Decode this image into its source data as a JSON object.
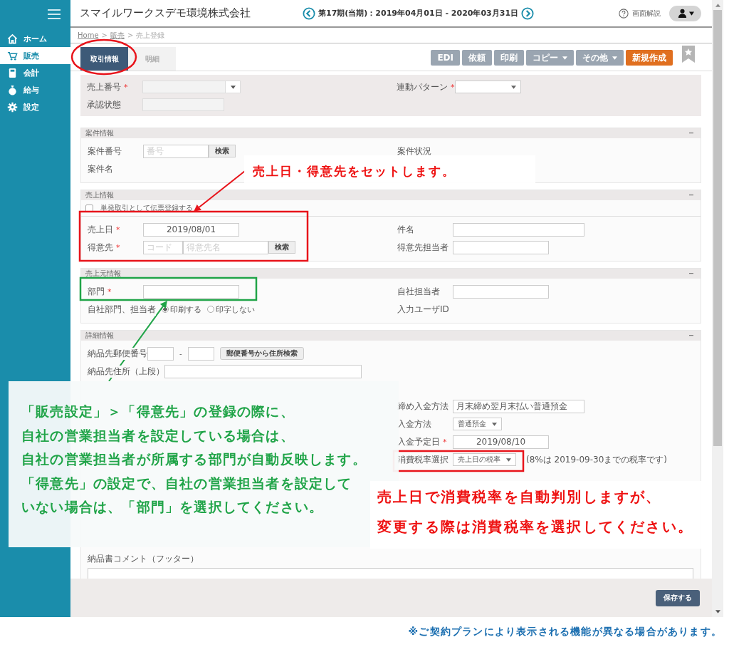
{
  "sidebar": {
    "items": [
      {
        "label": "ホーム",
        "selected": false
      },
      {
        "label": "販売",
        "selected": true
      },
      {
        "label": "会計",
        "selected": false
      },
      {
        "label": "給与",
        "selected": false
      },
      {
        "label": "設定",
        "selected": false
      }
    ]
  },
  "header": {
    "company": "スマイルワークスデモ環境株式会社",
    "period": "第17期(当期)：2019年04月01日 - 2020年03月31日",
    "help": "画面解説"
  },
  "breadcrumb": [
    {
      "label": "Home",
      "kind": "link"
    },
    {
      "label": ">",
      "kind": "separator"
    },
    {
      "label": "販売",
      "kind": "link"
    },
    {
      "label": ">",
      "kind": "separator"
    },
    {
      "label": "売上登録",
      "kind": "current"
    }
  ],
  "tabs": [
    {
      "label": "取引情報",
      "selected": true
    },
    {
      "label": "明細",
      "selected": false
    }
  ],
  "toolbar": [
    {
      "label": "EDI",
      "kind": "button",
      "disabled": true
    },
    {
      "label": "依頼",
      "kind": "button",
      "disabled": true
    },
    {
      "label": "印刷",
      "kind": "button",
      "disabled": true
    },
    {
      "label": "コピー",
      "kind": "dropdown",
      "disabled": true
    },
    {
      "label": "その他",
      "kind": "dropdown",
      "disabled": true
    },
    {
      "label": "新規作成",
      "kind": "button",
      "disabled": false
    }
  ],
  "sections": [
    {
      "kind": "plain",
      "left": [
        {
          "label": "売上番号",
          "mark": "*",
          "kind": "combo"
        },
        {
          "label": "承認状態",
          "kind": "readonly"
        }
      ],
      "right": [
        {
          "label": "連動パターン",
          "mark": "*",
          "kind": "select"
        }
      ]
    },
    {
      "kind": "basic",
      "title": "案件情報",
      "left": [
        {
          "label": "案件番号",
          "kind": "search",
          "placeholder": "番号",
          "button": "検索"
        },
        {
          "label": "案件名",
          "kind": "label"
        }
      ],
      "right": [
        {
          "label": "案件状況",
          "kind": "label"
        }
      ]
    },
    {
      "kind": "basic",
      "title": "売上情報",
      "checkbox": {
        "label": "単発取引として伝票登録する",
        "checked": false
      },
      "left": [
        {
          "label": "売上日",
          "mark": "*",
          "kind": "date",
          "value": "2019/08/01"
        },
        {
          "label": "得意先",
          "mark": "*",
          "kind": "customer",
          "placeholders": [
            "コード",
            "得意先名"
          ],
          "button": "検索"
        }
      ],
      "right": [
        {
          "label": "件名",
          "kind": "long-text"
        },
        {
          "label": "得意先担当者",
          "kind": "text"
        }
      ]
    },
    {
      "kind": "basic",
      "title": "売上元情報",
      "left": [
        {
          "label": "部門",
          "mark": "*",
          "kind": "text"
        },
        {
          "label": "自社部門、担当者",
          "kind": "radio",
          "options": [
            {
              "label": "印刷する",
              "selected": true
            },
            {
              "label": "印字しない",
              "selected": false
            }
          ]
        }
      ],
      "right": [
        {
          "label": "自社担当者",
          "kind": "text"
        },
        {
          "label": "入力ユーザID",
          "kind": "label"
        }
      ]
    },
    {
      "kind": "detail",
      "title": "詳細情報",
      "left": [
        {
          "label": "納品先郵便番号",
          "kind": "postal",
          "separator": "-",
          "button": "郵便番号から住所検索"
        },
        {
          "label": "納品先住所（上段）",
          "kind": "address"
        }
      ],
      "right": [
        {
          "label": "締め入金方法",
          "kind": "long-text",
          "value": "月末締め翌月末払い普通預金"
        },
        {
          "label": "入金方法",
          "kind": "select",
          "value": "普通預金"
        },
        {
          "label": "入金予定日",
          "mark": "*",
          "kind": "date",
          "value": "2019/08/10"
        },
        {
          "label": "消費税率選択",
          "kind": "select",
          "value": "売上日の税率",
          "note": "(8%は 2019-09-30までの税率です)"
        }
      ],
      "bottom": [
        {
          "label": "納品書コメント（フッター）",
          "kind": "textarea"
        }
      ]
    }
  ],
  "save_button": "保存する",
  "callouts": [
    {
      "color": "#ee1111",
      "lines": [
        "売上日・得意先をセットします。"
      ]
    },
    {
      "color": "#20a448",
      "lines": [
        "「販売設定」＞「得意先」の登録の際に、",
        "自社の営業担当者を設定している場合は、",
        "自社の営業担当者が所属する部門が自動反映します。",
        "「得意先」の設定で、自社の営業担当者を設定して",
        "いない場合は、「部門」を選択してください。"
      ]
    },
    {
      "color": "#ee1111",
      "lines": [
        "売上日で消費税率を自動判別しますが、",
        "変更する際は消費税率を選択してください。"
      ]
    }
  ],
  "footer_note": "※ご契約プランにより表示される機能が異なる場合があります。"
}
